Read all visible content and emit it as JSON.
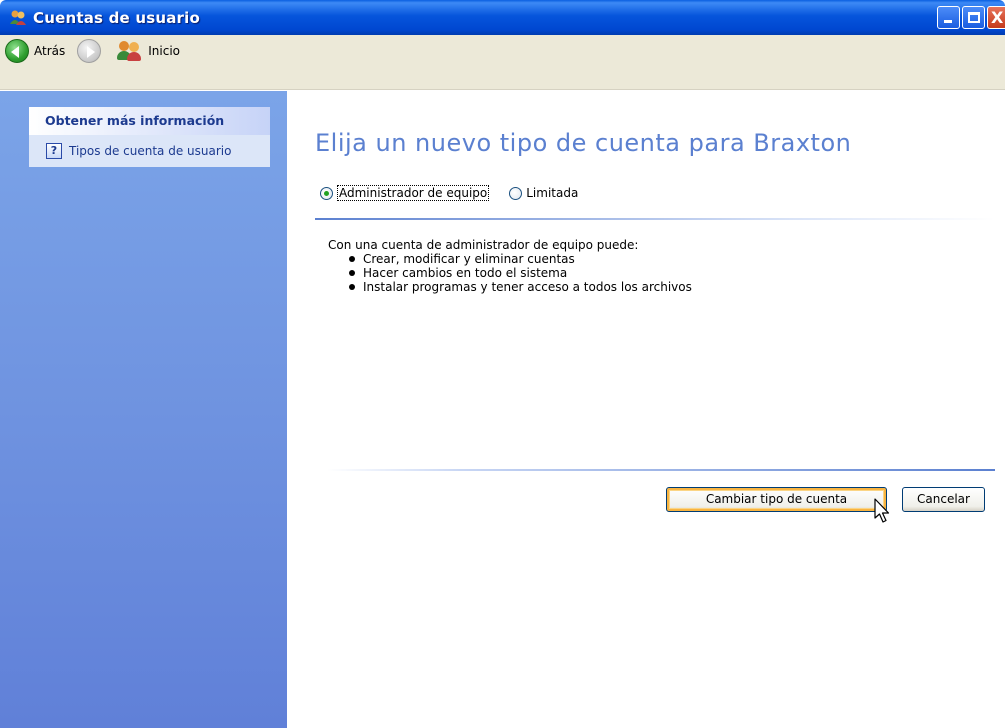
{
  "window": {
    "title": "Cuentas de usuario",
    "icon": "users-icon",
    "close_glyph": "X"
  },
  "toolbar": {
    "back_label": "Atrás",
    "home_label": "Inicio"
  },
  "sidebar": {
    "header": "Obtener más información",
    "link_icon_glyph": "?",
    "link_label": "Tipos de cuenta de usuario"
  },
  "main": {
    "heading": "Elija un nuevo tipo de cuenta para Braxton",
    "radio_options": [
      {
        "label": "Administrador de equipo",
        "selected": true
      },
      {
        "label": "Limitada",
        "selected": false
      }
    ],
    "description": "Con una cuenta de administrador de equipo puede:",
    "bullets": [
      "Crear, modificar y eliminar cuentas",
      "Hacer cambios en todo el sistema",
      "Instalar programas y tener acceso a todos los archivos"
    ],
    "primary_button": "Cambiar tipo de cuenta",
    "cancel_button": "Cancelar"
  },
  "colors": {
    "heading": "#5b80d0",
    "sidebar_header": "#1c3a8f",
    "titlebar": "#0655dc"
  }
}
